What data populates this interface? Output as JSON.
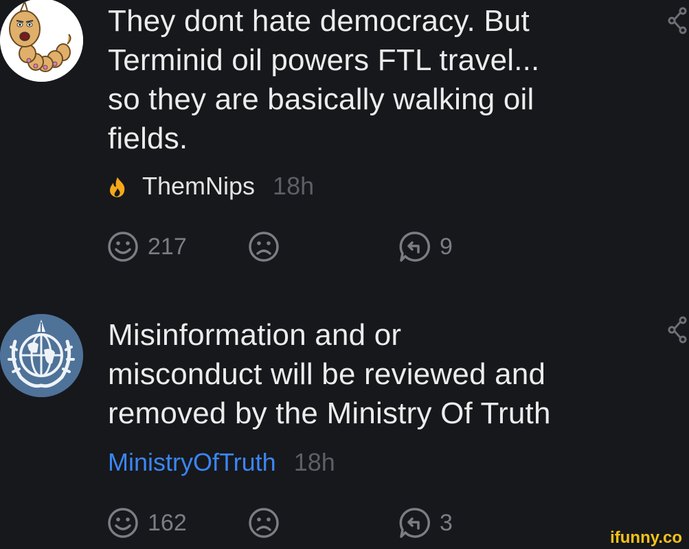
{
  "comments": [
    {
      "body_lines": [
        "They dont hate democracy. But",
        "Terminid oil powers FTL travel...",
        "so they are basically walking oil",
        "fields."
      ],
      "author": "ThemNips",
      "author_badge_icon": "flame-icon",
      "time": "18h",
      "upvotes": "217",
      "replies": "9"
    },
    {
      "body_lines": [
        "Misinformation and or",
        "misconduct will be reviewed and",
        "removed by the Ministry Of Truth"
      ],
      "author": "MinistryOfTruth",
      "author_color": "#3a86f5",
      "time": "18h",
      "upvotes": "162",
      "replies": "3"
    }
  ],
  "watermark": "ifunny.co",
  "colors": {
    "background": "#17181c",
    "text": "#ececec",
    "muted": "#7b7d84",
    "link_blue": "#3a86f5",
    "flame": "#f4a81a",
    "watermark": "#f4c21a"
  }
}
